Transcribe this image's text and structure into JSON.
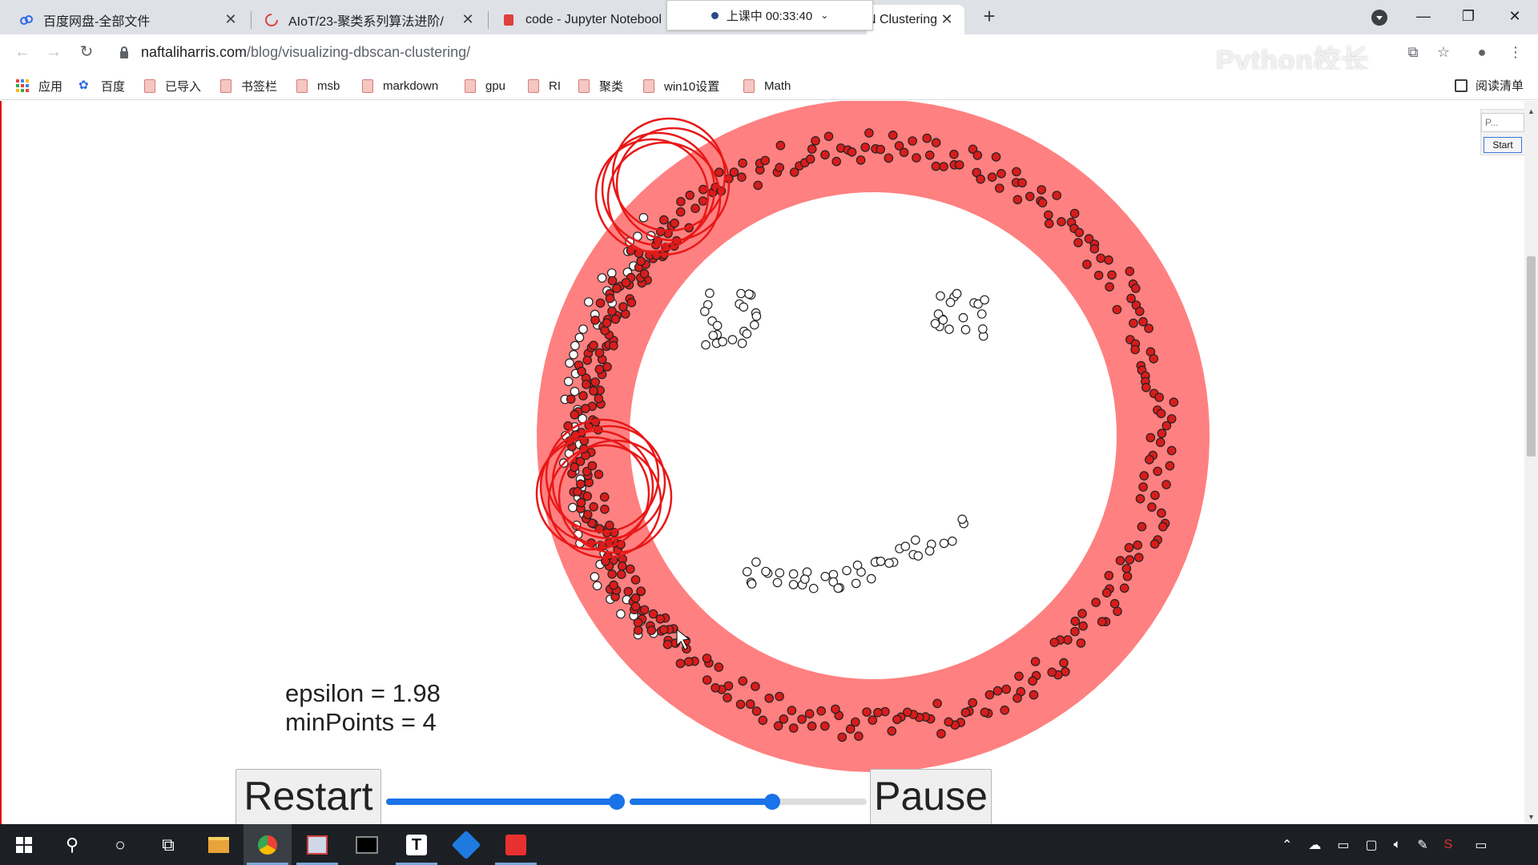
{
  "browser": {
    "tabs": [
      {
        "title": "百度网盘-全部文件",
        "favicon": "baidu-pan-icon"
      },
      {
        "title": "AIoT/23-聚类系列算法进阶/",
        "favicon": "loading-icon"
      },
      {
        "title": "code - Jupyter Notebook",
        "favicon": "jupyter-icon"
      },
      {
        "title": "N Clustering",
        "favicon": "page-icon"
      }
    ],
    "timer_label": "上课中 00:33:40",
    "url_host": "naftaliharris.com",
    "url_path": "/blog/visualizing-dbscan-clustering/",
    "watermark": "Python校长"
  },
  "bookmarks": [
    {
      "label": "应用",
      "icon": "apps-grid-icon"
    },
    {
      "label": "百度",
      "icon": "baidu-paw-icon"
    },
    {
      "label": "已导入",
      "icon": "folder-icon"
    },
    {
      "label": "书签栏",
      "icon": "folder-icon"
    },
    {
      "label": "msb",
      "icon": "folder-icon"
    },
    {
      "label": "markdown",
      "icon": "folder-icon"
    },
    {
      "label": "gpu",
      "icon": "folder-icon"
    },
    {
      "label": "RI",
      "icon": "folder-icon"
    },
    {
      "label": "聚类",
      "icon": "folder-icon"
    },
    {
      "label": "win10设置",
      "icon": "folder-icon"
    },
    {
      "label": "Math",
      "icon": "folder-icon"
    }
  ],
  "reading_list": "阅读清单",
  "dbscan": {
    "epsilon_text": "epsilon = 1.98",
    "minpoints_text": "minPoints = 4",
    "restart_label": "Restart",
    "pause_label": "Pause",
    "epsilon_slider_fraction": 0.98,
    "minpoints_slider_fraction": 0.6,
    "mini_input_placeholder": "P...",
    "mini_start_label": "Start",
    "colors": {
      "clustered_point": "#d81c1c",
      "unclustered_point": "#ffffff",
      "neighborhood": "#ff8080",
      "active_circle": "#e81818"
    }
  }
}
